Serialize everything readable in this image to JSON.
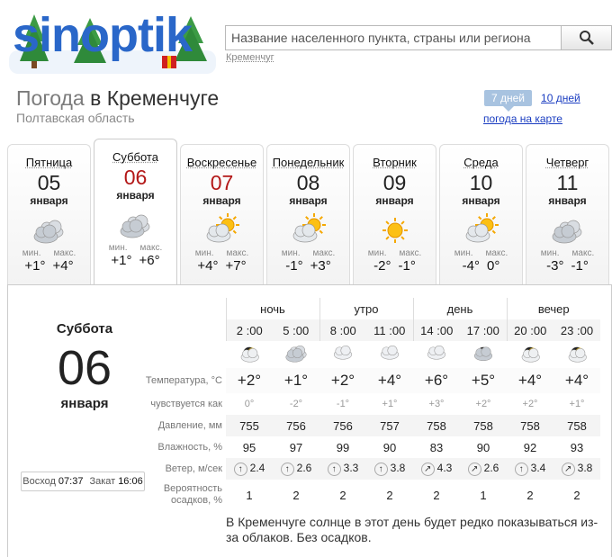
{
  "logo": {
    "text": "sinoptik"
  },
  "search": {
    "placeholder": "Название населенного пункта, страны или региона",
    "hint": "Кременчуг"
  },
  "title": {
    "prefix": "Погода",
    "city": "в Кременчуге"
  },
  "region": "Полтавская область",
  "range": {
    "active": "7 дней",
    "other": "10 дней",
    "map": "погода на карте"
  },
  "minmax": {
    "min": "мин.",
    "max": "макс."
  },
  "days": [
    {
      "name": "Пятница",
      "num": "05",
      "month": "января",
      "min": "+1°",
      "max": "+4°",
      "icon": "cloudy-icon",
      "red": false
    },
    {
      "name": "Суббота",
      "num": "06",
      "month": "января",
      "min": "+1°",
      "max": "+6°",
      "icon": "cloudy-icon",
      "red": true
    },
    {
      "name": "Воскресенье",
      "num": "07",
      "month": "января",
      "min": "+4°",
      "max": "+7°",
      "icon": "sun-cloud-icon",
      "red": true
    },
    {
      "name": "Понедельник",
      "num": "08",
      "month": "января",
      "min": "-1°",
      "max": "+3°",
      "icon": "sun-cloud-icon",
      "red": false
    },
    {
      "name": "Вторник",
      "num": "09",
      "month": "января",
      "min": "-2°",
      "max": "-1°",
      "icon": "sun-icon",
      "red": false
    },
    {
      "name": "Среда",
      "num": "10",
      "month": "января",
      "min": "-4°",
      "max": "0°",
      "icon": "sun-cloud-icon",
      "red": false
    },
    {
      "name": "Четверг",
      "num": "11",
      "month": "января",
      "min": "-3°",
      "max": "-1°",
      "icon": "cloudy-icon",
      "red": false
    }
  ],
  "selected": {
    "name": "Суббота",
    "num": "06",
    "month": "января",
    "sunrise_label": "Восход",
    "sunrise": "07:37",
    "sunset_label": "Закат",
    "sunset": "16:06"
  },
  "periods": [
    "ночь",
    "утро",
    "день",
    "вечер"
  ],
  "times": [
    "2 :00",
    "5 :00",
    "8 :00",
    "11 :00",
    "14 :00",
    "17 :00",
    "20 :00",
    "23 :00"
  ],
  "labels": {
    "temp": "Температура, °C",
    "feel": "чувствуется как",
    "pressure": "Давление, мм",
    "humidity": "Влажность, %",
    "wind": "Ветер, м/сек",
    "precip": "Вероятность осадков, %"
  },
  "temp": [
    "+2°",
    "+1°",
    "+2°",
    "+4°",
    "+6°",
    "+5°",
    "+4°",
    "+4°"
  ],
  "feel": [
    "0°",
    "-2°",
    "-1°",
    "+1°",
    "+3°",
    "+2°",
    "+2°",
    "+1°"
  ],
  "pressure": [
    "755",
    "756",
    "756",
    "757",
    "758",
    "758",
    "758",
    "758"
  ],
  "humidity": [
    "95",
    "97",
    "99",
    "90",
    "83",
    "90",
    "92",
    "93"
  ],
  "wind": [
    "2.4",
    "2.6",
    "3.3",
    "3.8",
    "4.3",
    "2.6",
    "3.4",
    "3.8"
  ],
  "wind_dir": [
    "↑",
    "↑",
    "↑",
    "↑",
    "↗",
    "↗",
    "↑",
    "↗"
  ],
  "precip": [
    "1",
    "2",
    "2",
    "2",
    "2",
    "1",
    "2",
    "2"
  ],
  "icons": [
    "night-cloud-icon",
    "night-overcast-icon",
    "cloud-icon",
    "cloud-icon",
    "cloud-icon",
    "overcast-icon",
    "night-cloud-icon",
    "night-cloud-icon"
  ],
  "description": "В Кременчуге солнце в этот день будет редко показываться из-за облаков. Без осадков.",
  "colors": {
    "accent": "#2a67c9",
    "link": "#1a3dc1",
    "weekend": "#b31818"
  }
}
